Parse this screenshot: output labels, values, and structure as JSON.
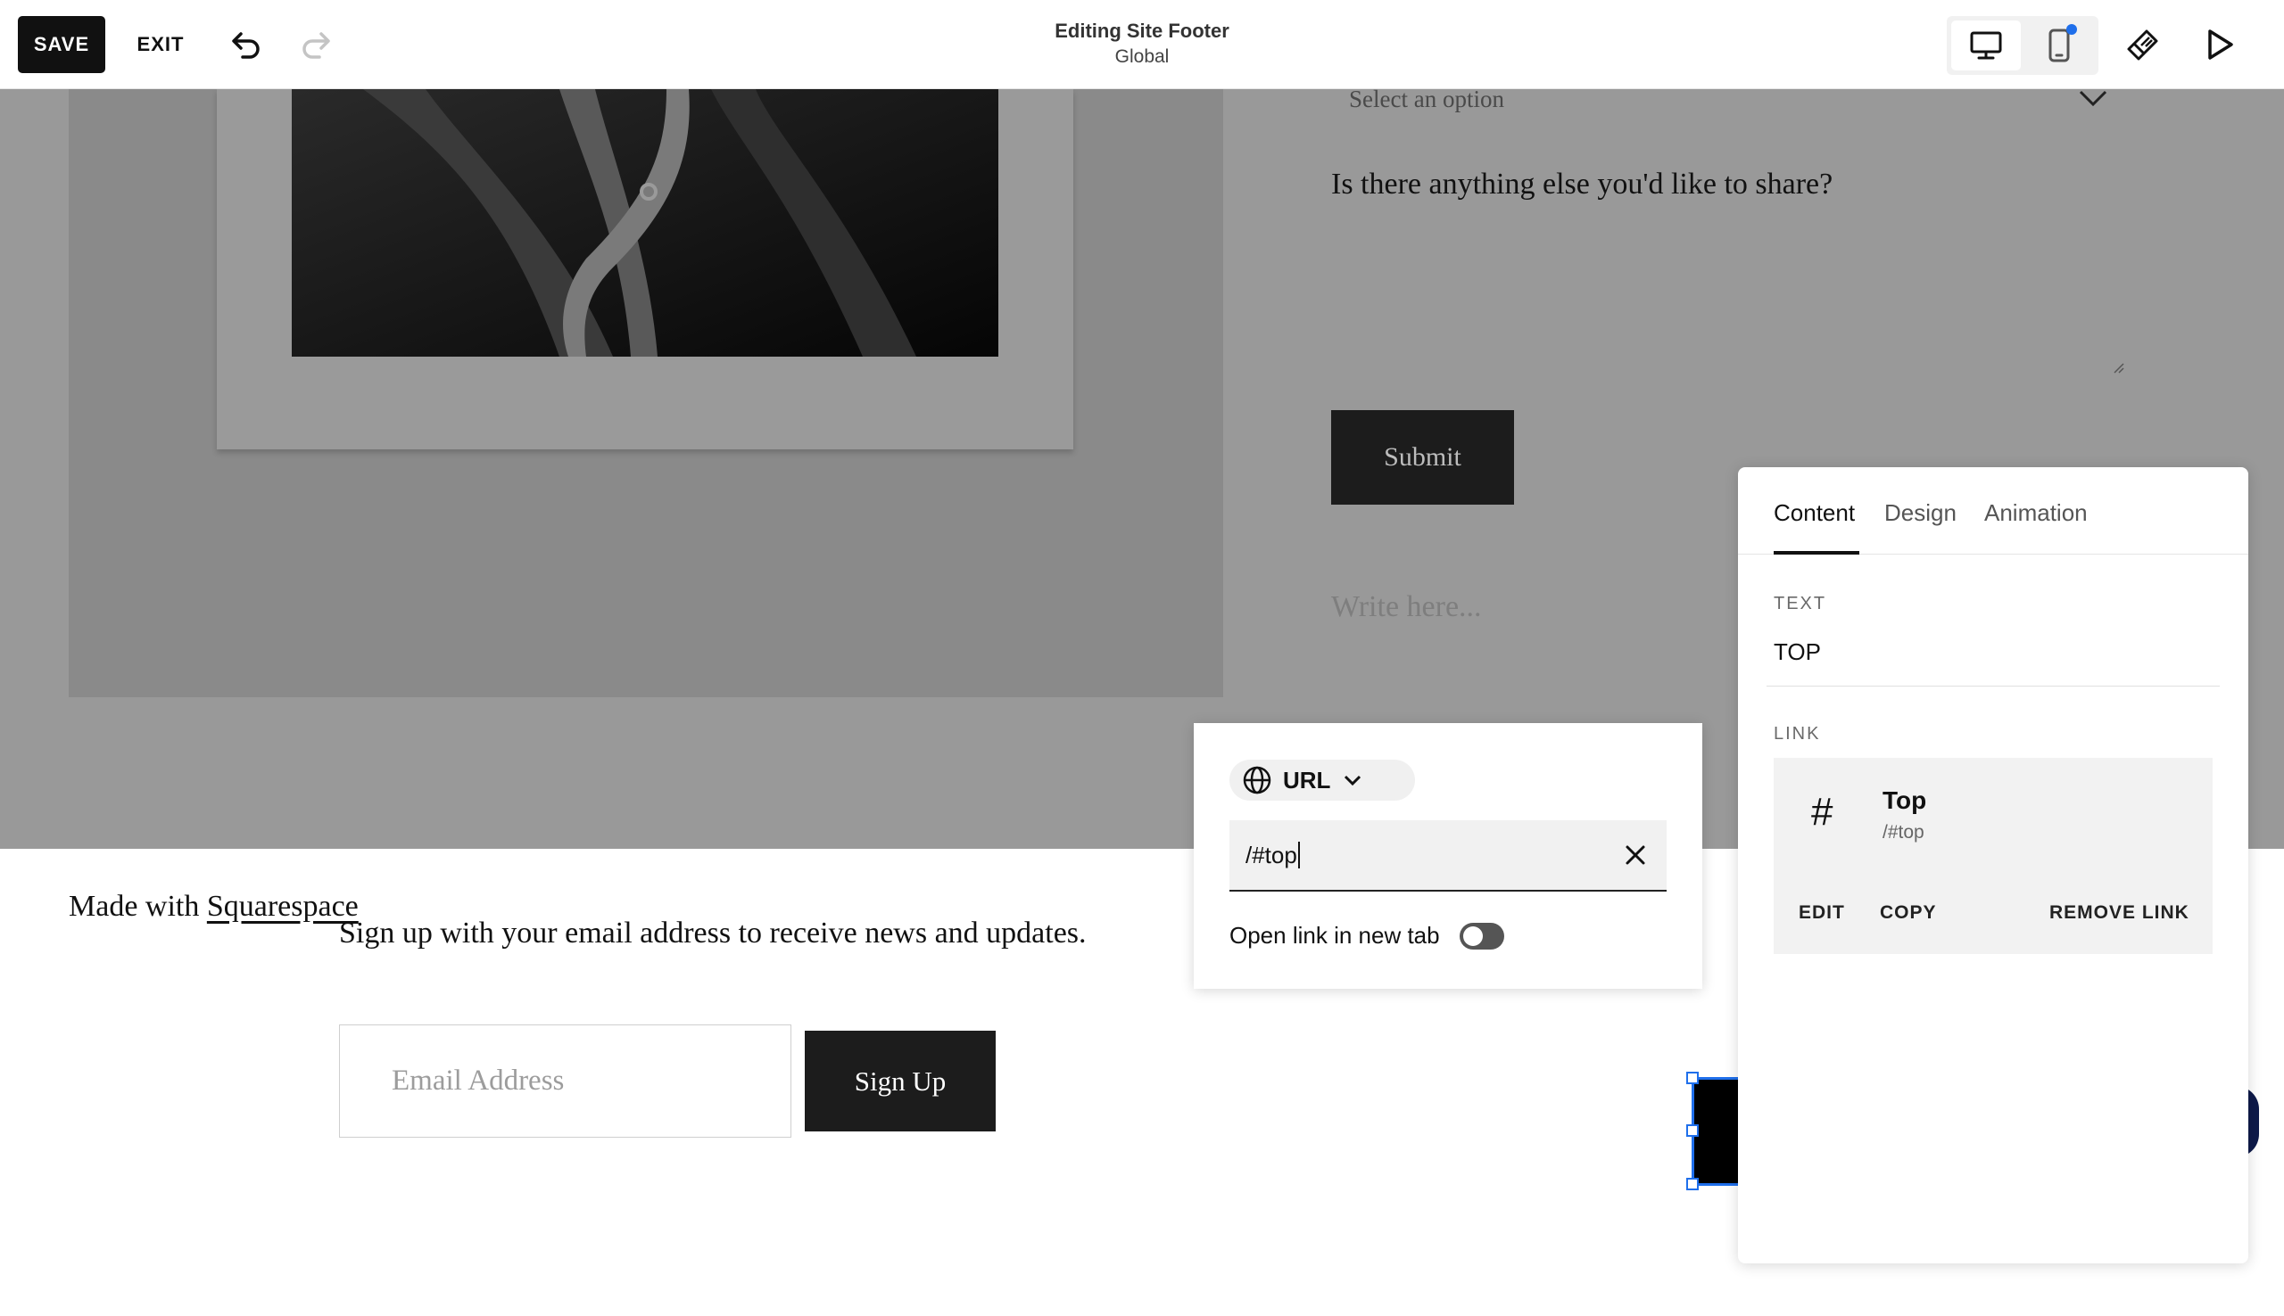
{
  "toolbar": {
    "save_label": "SAVE",
    "exit_label": "EXIT",
    "title": "Editing Site Footer",
    "subtitle": "Global",
    "accent_color": "#1f6feb"
  },
  "canvas": {
    "select_placeholder": "Select an option",
    "question": "Is there anything else you'd like to share?",
    "submit_label": "Submit",
    "textarea_placeholder": "Write here..."
  },
  "footer": {
    "made_with_prefix": "Made with",
    "made_with_link": "Squarespace",
    "signup_text": "Sign up with your email address to receive news and updates.",
    "email_placeholder": "Email Address",
    "signup_button": "Sign Up"
  },
  "link_popover": {
    "type_label": "URL",
    "url_value": "/#top",
    "open_new_tab_label": "Open link in new tab",
    "open_new_tab": false
  },
  "panel": {
    "tabs": [
      {
        "label": "Content",
        "active": true
      },
      {
        "label": "Design",
        "active": false
      },
      {
        "label": "Animation",
        "active": false
      }
    ],
    "text_section_label": "TEXT",
    "text_value": "TOP",
    "link_section_label": "LINK",
    "link_card": {
      "icon": "#",
      "title": "Top",
      "subtitle": "/#top",
      "actions": [
        "EDIT",
        "COPY",
        "REMOVE LINK"
      ]
    }
  }
}
